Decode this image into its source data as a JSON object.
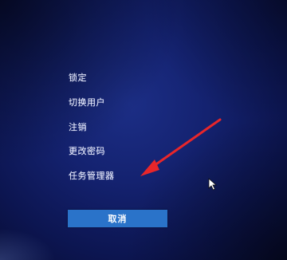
{
  "menu": {
    "lock": "锁定",
    "switch_user": "切换用户",
    "sign_out": "注销",
    "change_password": "更改密码",
    "task_manager": "任务管理器"
  },
  "cancel_button": {
    "label": "取消"
  },
  "colors": {
    "background": "#142270",
    "text": "#e8ecff",
    "button": "#2a73c9",
    "annotation_arrow": "#e8262a"
  },
  "icons": {
    "cursor": "mouse-pointer-icon",
    "annotation": "red-arrow-icon"
  }
}
